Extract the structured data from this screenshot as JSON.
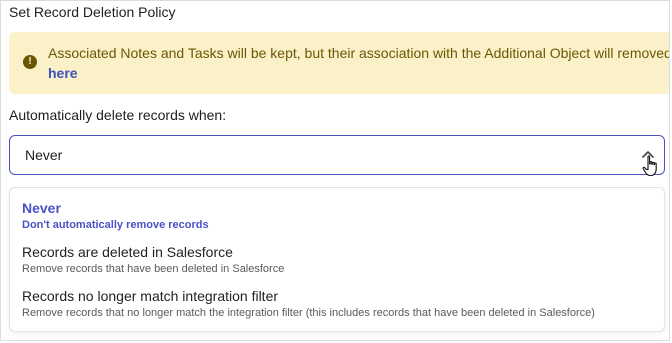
{
  "section": {
    "title": "Set Record Deletion Policy"
  },
  "warning": {
    "icon": "exclamation-circle-icon",
    "text": "Associated Notes and Tasks will be kept, but their association with the Additional Object will removed",
    "link_label": "here",
    "color_bg": "#fbf1c9",
    "color_text": "#6b5703"
  },
  "deletion_field": {
    "label": "Automatically delete records when:",
    "selected_value": "Never",
    "accent_color": "#4a52c4"
  },
  "dropdown": {
    "options": [
      {
        "title": "Never",
        "description": "Don't automatically remove records",
        "selected": true
      },
      {
        "title": "Records are deleted in Salesforce",
        "description": "Remove records that have been deleted in Salesforce",
        "selected": false
      },
      {
        "title": "Records no longer match integration filter",
        "description": "Remove records that no longer match the integration filter (this includes records that have been deleted in Salesforce)",
        "selected": false
      }
    ]
  }
}
